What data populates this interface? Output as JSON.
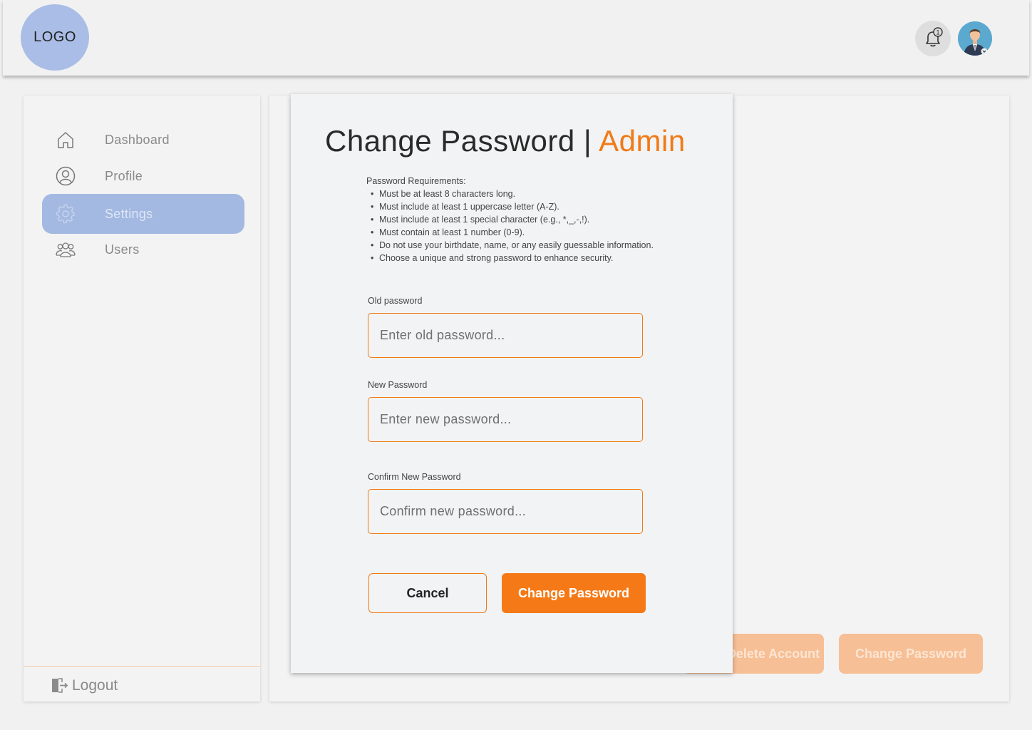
{
  "header": {
    "logo_text": "LOGO",
    "notification_count": "1",
    "bell_icon": "bell-icon",
    "avatar_icon": "user-avatar"
  },
  "sidebar": {
    "items": [
      {
        "label": "Dashboard",
        "icon": "home-icon",
        "active": false
      },
      {
        "label": "Profile",
        "icon": "user-circle-icon",
        "active": false
      },
      {
        "label": "Settings",
        "icon": "gear-icon",
        "active": true
      },
      {
        "label": "Users",
        "icon": "users-icon",
        "active": false
      }
    ],
    "logout_label": "Logout",
    "logout_icon": "logout-icon"
  },
  "background": {
    "delete_account_label": "Delete Account",
    "change_password_label": "Change Password"
  },
  "modal": {
    "title": "Change Password | ",
    "title_role": "Admin",
    "requirements_heading": "Password Requirements:",
    "requirements": [
      "Must be at least 8 characters long.",
      "Must include at least 1 uppercase letter (A-Z).",
      "Must include at least 1 special character (e.g., *,_,-,!).",
      "Must contain at least 1 number (0-9).",
      "Do not use your birthdate, name, or any easily guessable information.",
      "Choose a unique and strong password to enhance security."
    ],
    "old_password": {
      "label": "Old password",
      "placeholder": "Enter old password...",
      "value": ""
    },
    "new_password": {
      "label": "New Password",
      "placeholder": "Enter new password...",
      "value": ""
    },
    "confirm_password": {
      "label": "Confirm New Password",
      "placeholder": "Confirm new password...",
      "value": ""
    },
    "cancel_label": "Cancel",
    "submit_label": "Change Password"
  },
  "colors": {
    "accent": "#f57a17",
    "sidebar_active": "#a3b9e2",
    "logo_bg": "#a9bde6"
  }
}
